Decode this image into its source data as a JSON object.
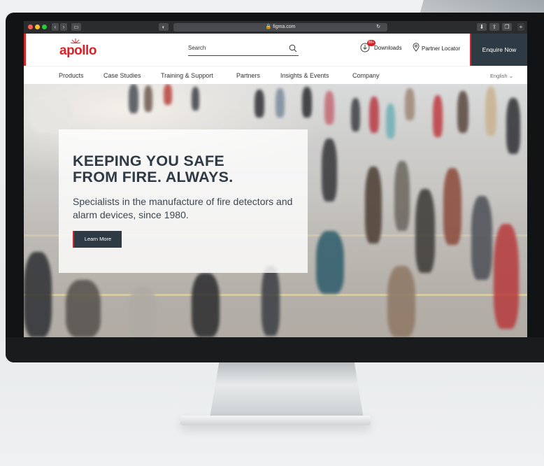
{
  "browser": {
    "url": "figma.com"
  },
  "header": {
    "logo_text": "apollo",
    "search_placeholder": "Search",
    "downloads_label": "Downloads",
    "downloads_badge": "99+",
    "partner_locator_label": "Partner Locator",
    "enquire_label": "Enquire Now"
  },
  "nav": {
    "items": [
      "Products",
      "Case Studies",
      "Training & Support",
      "Partners",
      "Insights & Events",
      "Company"
    ],
    "language": "English"
  },
  "hero": {
    "headline_line1": "KEEPING YOU SAFE",
    "headline_line2": "FROM FIRE. ALWAYS.",
    "subtext": "Specialists in the manufacture of fire detectors and alarm devices, since 1980.",
    "button_label": "Learn More"
  },
  "colors": {
    "brand_red": "#d9232a",
    "navy": "#2e3a44"
  }
}
